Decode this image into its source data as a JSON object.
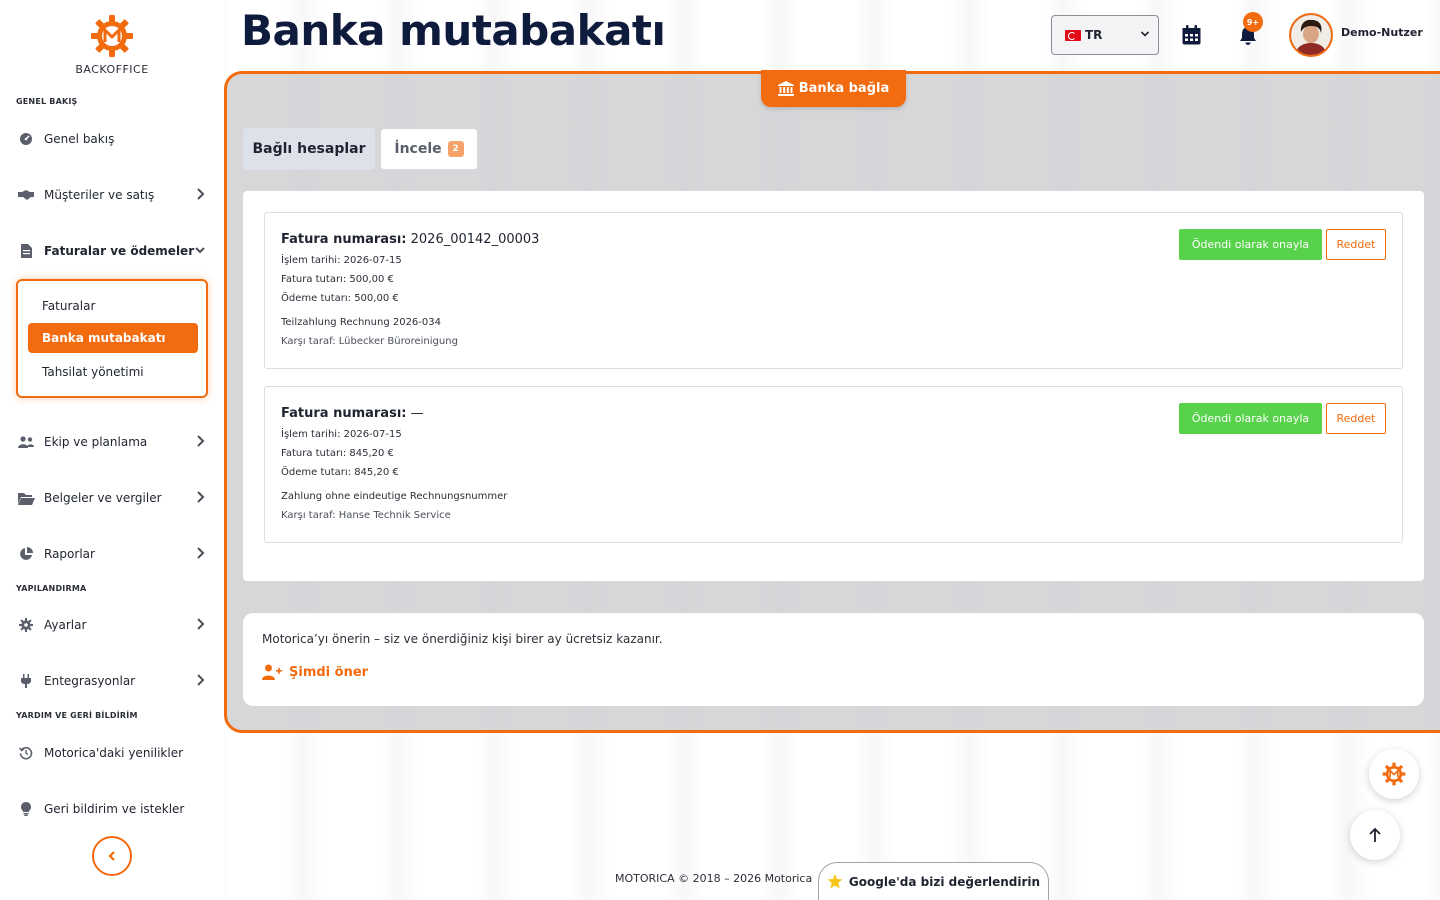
{
  "app": {
    "logo_text": "BACKOFFICE",
    "page_title": "Banka mutabakatı"
  },
  "header": {
    "language": "TR",
    "notifications_badge": "9+",
    "user_name": "Demo-Nutzer"
  },
  "sidebar": {
    "sections": {
      "overview": "GENEL BAKIŞ",
      "configuration": "YAPILANDIRMA",
      "help": "YARDIM VE GERİ BİLDİRİM"
    },
    "items": {
      "overview": "Genel bakış",
      "customers": "Müşteriler ve satış",
      "invoices": "Faturalar ve ödemeler",
      "team": "Ekip ve planlama",
      "documents": "Belgeler ve vergiler",
      "reports": "Raporlar",
      "settings": "Ayarlar",
      "integrations": "Entegrasyonlar",
      "whats_new": "Motorica'daki yenilikler",
      "feedback": "Geri bildirim ve istekler"
    },
    "subitems": {
      "invoices": "Faturalar",
      "bank_reconciliation": "Banka mutabakatı",
      "collections": "Tahsilat yönetimi"
    }
  },
  "main": {
    "connect_bank": "Banka bağla",
    "tabs": {
      "linked_accounts": "Bağlı hesaplar",
      "review": "İncele",
      "review_count": "2"
    },
    "labels": {
      "invoice_number": "Fatura numarası:",
      "confirm_paid": "Ödendi olarak onayla",
      "reject": "Reddet"
    },
    "transactions": [
      {
        "invoice_number": "2026_00142_00003",
        "transaction_date": "İşlem tarihi: 2026-07-15",
        "invoice_amount": "Fatura tutarı: 500,00 €",
        "payment_amount": "Ödeme tutarı: 500,00 €",
        "reference": "Teilzahlung Rechnung 2026-034",
        "counterparty": "Karşı taraf: Lübecker Büroreinigung"
      },
      {
        "invoice_number": "—",
        "transaction_date": "İşlem tarihi: 2026-07-15",
        "invoice_amount": "Fatura tutarı: 845,20 €",
        "payment_amount": "Ödeme tutarı: 845,20 €",
        "reference": "Zahlung ohne eindeutige Rechnungsnummer",
        "counterparty": "Karşı taraf: Hanse Technik Service"
      }
    ]
  },
  "referral": {
    "message": "Motorica’yı önerin – siz ve önerdiğiniz kişi birer ay ücretsiz kazanır.",
    "cta": "Şimdi öner"
  },
  "footer": {
    "copyright": "MOTORICA © 2018 – 2026 Motorica",
    "google_rating": "Google'da bizi değerlendirin"
  },
  "colors": {
    "accent": "#f26b0f",
    "success": "#57d24a",
    "title": "#0f1b3d"
  }
}
